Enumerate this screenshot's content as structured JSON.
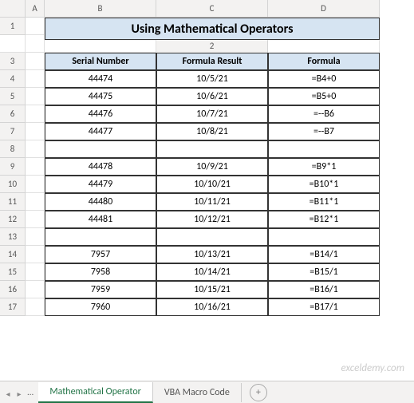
{
  "columns": [
    "A",
    "B",
    "C",
    "D"
  ],
  "rows": [
    "1",
    "2",
    "3",
    "4",
    "5",
    "6",
    "7",
    "8",
    "9",
    "10",
    "11",
    "12",
    "13",
    "14",
    "15",
    "16",
    "17"
  ],
  "title": "Using Mathematical Operators",
  "headers": {
    "b": "Serial Number",
    "c": "Formula Result",
    "d": "Formula"
  },
  "data": [
    {
      "b": "44474",
      "c": "10/5/21",
      "d": "=B4+0"
    },
    {
      "b": "44475",
      "c": "10/6/21",
      "d": "=B5+0"
    },
    {
      "b": "44476",
      "c": "10/7/21",
      "d": "=--B6"
    },
    {
      "b": "44477",
      "c": "10/8/21",
      "d": "=--B7"
    },
    {
      "b": "",
      "c": "",
      "d": ""
    },
    {
      "b": "44478",
      "c": "10/9/21",
      "d": "=B9*1"
    },
    {
      "b": "44479",
      "c": "10/10/21",
      "d": "=B10*1"
    },
    {
      "b": "44480",
      "c": "10/11/21",
      "d": "=B11*1"
    },
    {
      "b": "44481",
      "c": "10/12/21",
      "d": "=B12*1"
    },
    {
      "b": "",
      "c": "",
      "d": ""
    },
    {
      "b": "7957",
      "c": "10/13/21",
      "d": "=B14/1"
    },
    {
      "b": "7958",
      "c": "10/14/21",
      "d": "=B15/1"
    },
    {
      "b": "7959",
      "c": "10/15/21",
      "d": "=B16/1"
    },
    {
      "b": "7960",
      "c": "10/16/21",
      "d": "=B17/1"
    }
  ],
  "tabs": {
    "nav": "...",
    "active": "Mathematical Operator",
    "other": "VBA Macro Code",
    "add": "+"
  },
  "watermark": "exceldemy.com",
  "nav": {
    "left": "◂",
    "right": "▸"
  }
}
